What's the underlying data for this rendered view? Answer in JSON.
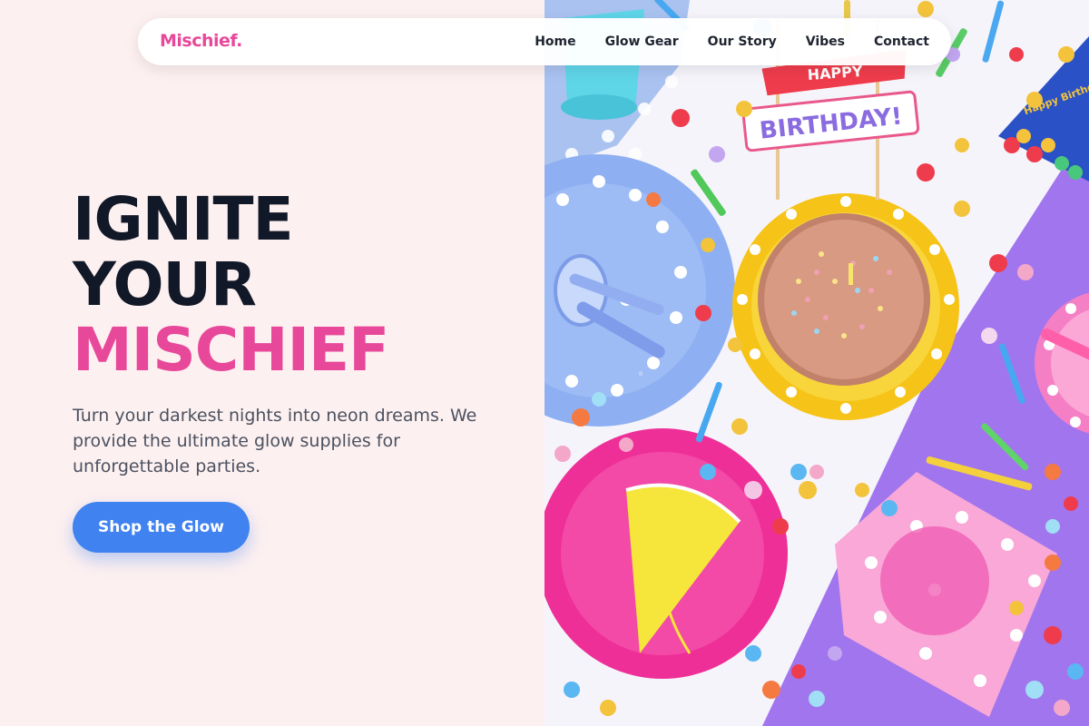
{
  "nav": {
    "brand": "Mischief.",
    "links": [
      "Home",
      "Glow Gear",
      "Our Story",
      "Vibes",
      "Contact"
    ]
  },
  "hero": {
    "title_line1": "IGNITE",
    "title_line2": "YOUR",
    "title_accent": "MISCHIEF",
    "subtitle": "Turn your darkest nights into neon dreams. We provide the ultimate glow supplies for unforgettable parties.",
    "cta_label": "Shop the Glow"
  },
  "image": {
    "banner_text": "BIRTHDAY!",
    "banner_top_text": "HAPPY",
    "hat_text": "Happy Birthday"
  },
  "colors": {
    "accent": "#e8489a",
    "cta": "#3f82f0",
    "heading": "#111827",
    "background": "#fdf0f0"
  }
}
